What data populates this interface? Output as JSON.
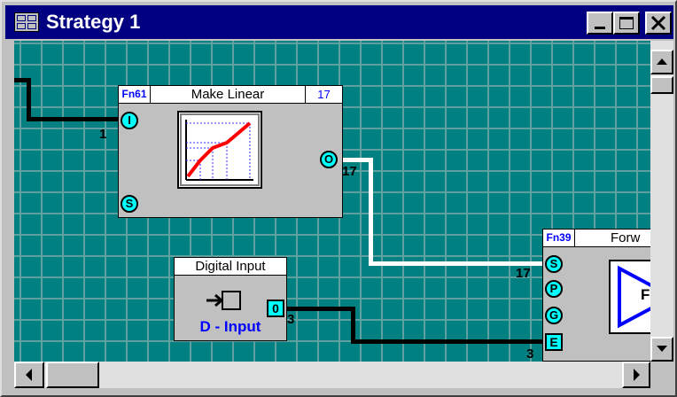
{
  "window": {
    "title": "Strategy 1"
  },
  "blocks": {
    "make_linear": {
      "fn_id": "Fn61",
      "name": "Make Linear",
      "number": "17",
      "input_pin": "I",
      "output_pin": "O",
      "start_pin": "S"
    },
    "digital_input": {
      "name": "Digital Input",
      "value_label": "D - Input",
      "output_pin": "0"
    },
    "forward": {
      "fn_id": "Fn39",
      "name": "Forw",
      "pins": [
        "S",
        "P",
        "G",
        "E"
      ],
      "preview_letter": "F"
    }
  },
  "wire_labels": {
    "in1": "1",
    "out17": "17",
    "s17": "17",
    "di3": "3",
    "e3": "3"
  },
  "colors": {
    "canvas": "#008080",
    "grid": "#5fa0a0",
    "pin": "#00ffff",
    "title_bar": "#000080",
    "id_text": "#0000ff"
  },
  "icons": [
    "window-app-icon",
    "minimize-icon",
    "maximize-icon",
    "close-icon",
    "make-linear-graph-icon",
    "digital-input-icon",
    "forward-triangle-icon",
    "scroll-up-icon",
    "scroll-down-icon",
    "scroll-left-icon",
    "scroll-right-icon"
  ]
}
